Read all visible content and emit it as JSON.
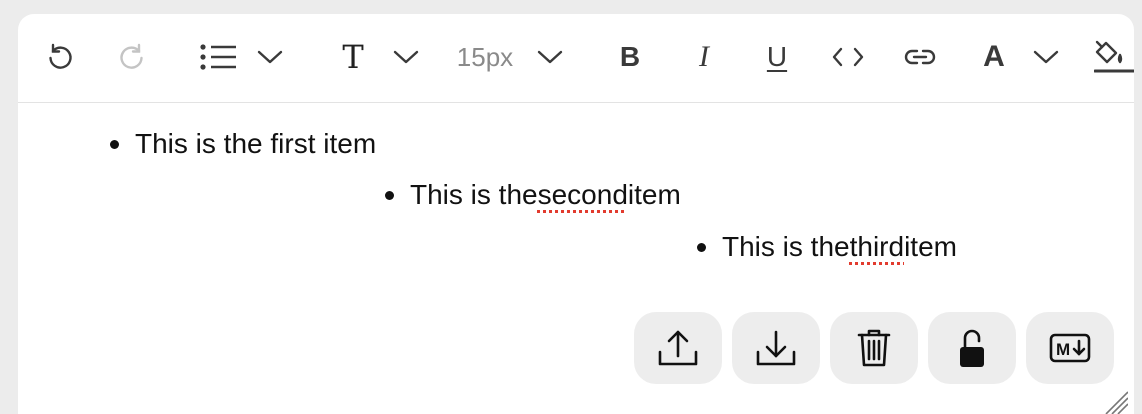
{
  "toolbar": {
    "font_size": "15px",
    "bold_label": "B",
    "italic_label": "I",
    "underline_label": "U",
    "text_style_label": "T",
    "font_color_label": "A",
    "icons": [
      "undo-icon",
      "redo-icon",
      "list-icon",
      "chevron-down-icon",
      "code-icon",
      "link-icon",
      "paint-bucket-icon"
    ]
  },
  "content": {
    "items": [
      {
        "before": "This is the first item",
        "misspelled": "",
        "after": ""
      },
      {
        "before": "This is the ",
        "misspelled": "second",
        "after": " item"
      },
      {
        "before": "This is the ",
        "misspelled": "third",
        "after": " item"
      }
    ]
  },
  "actions": {
    "icons": [
      "upload-icon",
      "download-icon",
      "trash-icon",
      "lock-icon",
      "markdown-icon"
    ],
    "markdown_label": "M"
  },
  "colors": {
    "accent_underline": "#e23b2e",
    "button_bg": "#ededed",
    "disabled": "#c4c4c4"
  }
}
